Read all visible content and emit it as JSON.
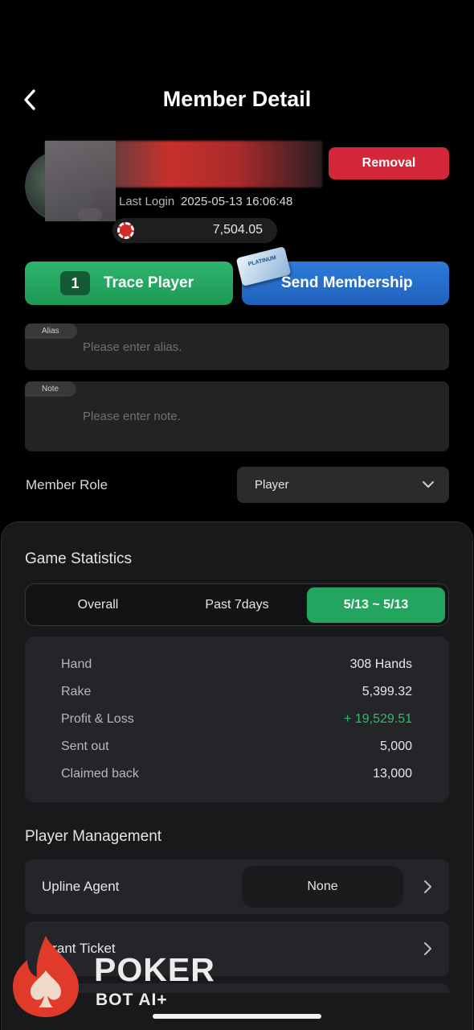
{
  "header": {
    "title": "Member Detail"
  },
  "profile": {
    "last_login_label": "Last Login",
    "last_login_value": "2025-05-13 16:06:48",
    "balance": "7,504.05",
    "removal_label": "Removal"
  },
  "actions": {
    "trace_count": "1",
    "trace_label": "Trace Player",
    "membership_label": "Send Membership",
    "membership_card_text": "PLATINUM"
  },
  "alias": {
    "tag": "Alias",
    "placeholder": "Please enter alias."
  },
  "note": {
    "tag": "Note",
    "placeholder": "Please enter note."
  },
  "member_role": {
    "label": "Member Role",
    "value": "Player"
  },
  "game_statistics": {
    "title": "Game Statistics",
    "tabs": [
      {
        "label": "Overall"
      },
      {
        "label": "Past 7days"
      },
      {
        "label": "5/13 ~ 5/13"
      }
    ],
    "active_tab": 2,
    "rows": [
      {
        "label": "Hand",
        "value": "308 Hands"
      },
      {
        "label": "Rake",
        "value": "5,399.32"
      },
      {
        "label": "Profit & Loss",
        "value": "+ 19,529.51"
      },
      {
        "label": "Sent out",
        "value": "5,000"
      },
      {
        "label": "Claimed back",
        "value": "13,000"
      }
    ],
    "positive_color": "#2ebd6b"
  },
  "player_management": {
    "title": "Player Management",
    "upline_agent": {
      "label": "Upline Agent",
      "value": "None"
    },
    "grant_ticket": {
      "label": "Grant Ticket"
    }
  },
  "watermark": {
    "line1": "POKER",
    "line2": "BOT AI+"
  },
  "colors": {
    "removal": "#d3283a",
    "trace": "#1d9a56",
    "membership": "#1f62bd",
    "active_tab": "#23a45f"
  }
}
